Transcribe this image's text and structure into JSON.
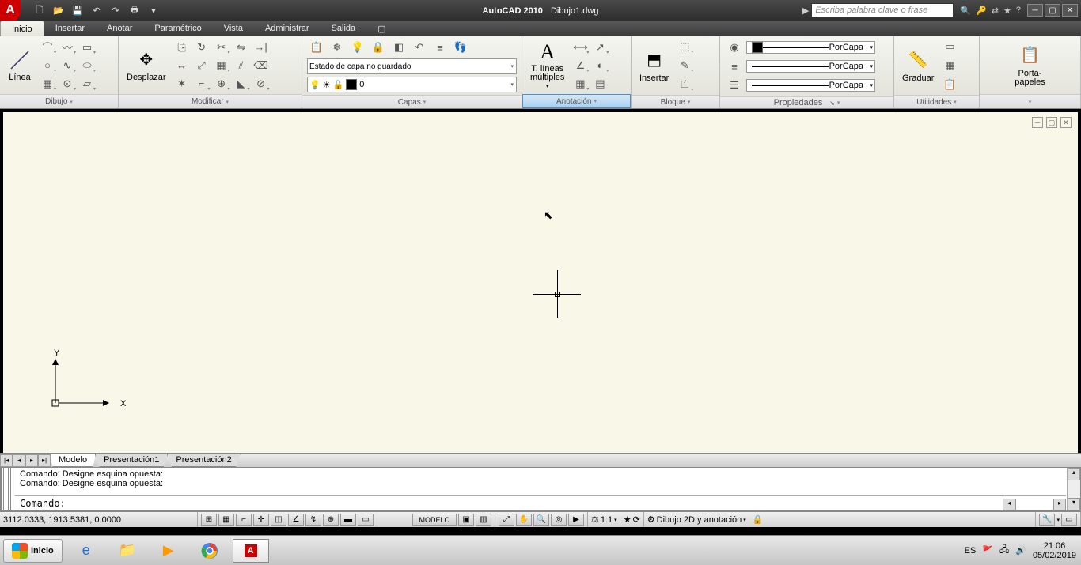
{
  "title": {
    "app": "AutoCAD 2010",
    "file": "Dibujo1.dwg",
    "search_placeholder": "Escriba palabra clave o frase"
  },
  "menu": {
    "m0": "Inicio",
    "m1": "Insertar",
    "m2": "Anotar",
    "m3": "Paramétrico",
    "m4": "Vista",
    "m5": "Administrar",
    "m6": "Salida"
  },
  "ribbon": {
    "dibujo": {
      "title": "Dibujo",
      "linea": "Línea"
    },
    "modificar": {
      "title": "Modificar",
      "desplazar": "Desplazar"
    },
    "capas": {
      "title": "Capas",
      "state": "Estado de capa no guardado",
      "layer": "0"
    },
    "anotacion": {
      "title": "Anotación",
      "texto": "T. líneas\nmúltiples"
    },
    "bloque": {
      "title": "Bloque",
      "insertar": "Insertar"
    },
    "propiedades": {
      "title": "Propiedades",
      "porcapa": "PorCapa"
    },
    "utilidades": {
      "title": "Utilidades",
      "graduar": "Graduar"
    },
    "porta": "Porta-\npapeles"
  },
  "tabs": {
    "t0": "Modelo",
    "t1": "Presentación1",
    "t2": "Presentación2"
  },
  "cmd": {
    "l1": "Comando: Designe esquina opuesta:",
    "l2": "Comando: Designe esquina opuesta:",
    "prompt": "Comando:"
  },
  "status": {
    "coords": "3112.0333, 1913.5381, 0.0000",
    "model": "MODELO",
    "scale": "1:1",
    "workspace": "Dibujo 2D y anotación",
    "lang": "ES"
  },
  "task": {
    "start": "Inicio",
    "time": "21:06",
    "date": "05/02/2019"
  },
  "ucs": {
    "x": "X",
    "y": "Y"
  }
}
